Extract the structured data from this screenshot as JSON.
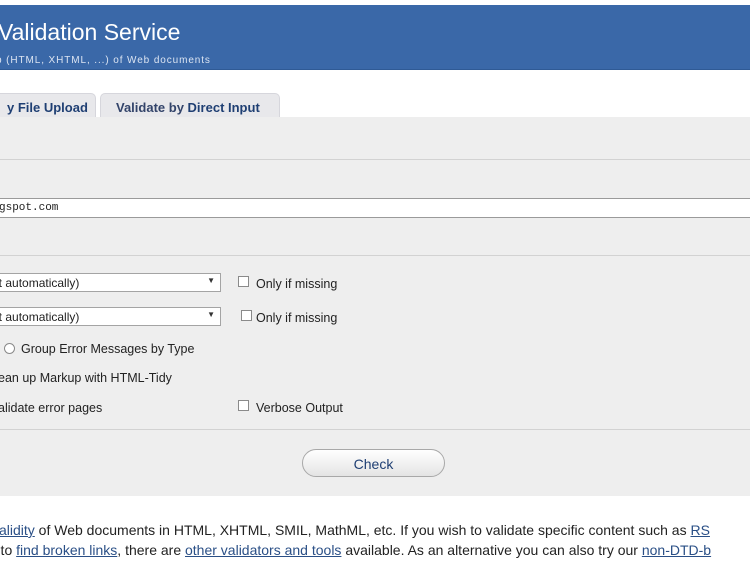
{
  "header": {
    "title": "Validation Service",
    "subtitle": "p (HTML, XHTML, ...) of Web documents"
  },
  "tabs": {
    "upload_label": "y File Upload",
    "direct_lead": "Validate by ",
    "direct_label": "Direct Input"
  },
  "form": {
    "uri_value": "gspot.com",
    "charset": {
      "selected": "ect automatically)",
      "only_if_missing": "Only if missing"
    },
    "doctype": {
      "selected": "ect automatically)",
      "only_if_missing": "Only if missing"
    },
    "group_errors_label": "Group Error Messages by Type",
    "cleanup_label": "ean up Markup with HTML-Tidy",
    "validate_error_pages_label": "alidate error pages",
    "verbose_output_label": "Verbose Output",
    "check_label": "Check"
  },
  "intro": {
    "line1_link_validity": "validity",
    "line1_text": " of Web documents in HTML, XHTML, SMIL, MathML, etc. If you wish to validate specific content such as ",
    "line1_link_rss": "RS",
    "line2_prefix": "r to ",
    "line2_link_broken": "find broken links",
    "line2_mid": ", there are ",
    "line2_link_other": "other validators and tools",
    "line2_mid2": " available. As an alternative you can also try our ",
    "line2_link_nondtd": "non-DTD-b"
  }
}
